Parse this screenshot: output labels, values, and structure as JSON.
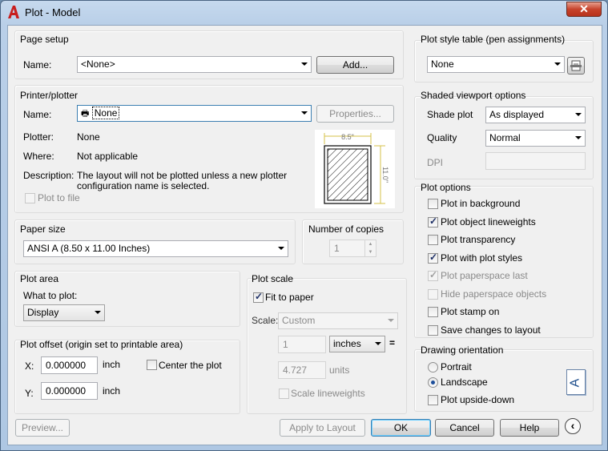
{
  "window": {
    "title": "Plot - Model",
    "close_glyph": "✕",
    "logo_letter": "A"
  },
  "page_setup": {
    "title": "Page setup",
    "name_label": "Name:",
    "name_value": "<None>",
    "add_button": "Add..."
  },
  "printer": {
    "title": "Printer/plotter",
    "name_label": "Name:",
    "name_value": "None",
    "properties_button": "Properties...",
    "plotter_label": "Plotter:",
    "plotter_value": "None",
    "where_label": "Where:",
    "where_value": "Not applicable",
    "description_label": "Description:",
    "description_line1": "The layout will not be plotted unless a new plotter",
    "description_line2": "configuration name is selected.",
    "plot_to_file": "Plot to file",
    "preview_width": "8.5\"",
    "preview_height": "11.0\""
  },
  "paper_size": {
    "title": "Paper size",
    "value": "ANSI A (8.50 x 11.00 Inches)"
  },
  "copies": {
    "title": "Number of copies",
    "value": "1"
  },
  "plot_area": {
    "title": "Plot area",
    "what_label": "What to plot:",
    "what_value": "Display"
  },
  "plot_offset": {
    "title": "Plot offset (origin set to printable area)",
    "x_label": "X:",
    "x_value": "0.000000",
    "x_unit": "inch",
    "y_label": "Y:",
    "y_value": "0.000000",
    "y_unit": "inch",
    "center_label": "Center the plot"
  },
  "plot_scale": {
    "title": "Plot scale",
    "fit_label": "Fit to paper",
    "scale_label": "Scale:",
    "scale_value": "Custom",
    "num_value": "1",
    "unit_value": "inches",
    "equals": "=",
    "den_value": "4.727",
    "den_unit": "units",
    "lineweights_label": "Scale lineweights"
  },
  "plot_style": {
    "title": "Plot style table (pen assignments)",
    "value": "None"
  },
  "shaded": {
    "title": "Shaded viewport options",
    "shade_label": "Shade plot",
    "shade_value": "As displayed",
    "quality_label": "Quality",
    "quality_value": "Normal",
    "dpi_label": "DPI",
    "dpi_value": ""
  },
  "plot_options": {
    "title": "Plot options",
    "items": [
      {
        "label": "Plot in background",
        "checked": false,
        "disabled": false
      },
      {
        "label": "Plot object lineweights",
        "checked": true,
        "disabled": false
      },
      {
        "label": "Plot transparency",
        "checked": false,
        "disabled": false
      },
      {
        "label": "Plot with plot styles",
        "checked": true,
        "disabled": false
      },
      {
        "label": "Plot paperspace last",
        "checked": true,
        "disabled": true
      },
      {
        "label": "Hide paperspace objects",
        "checked": false,
        "disabled": true
      },
      {
        "label": "Plot stamp on",
        "checked": false,
        "disabled": false
      },
      {
        "label": "Save changes to layout",
        "checked": false,
        "disabled": false
      }
    ]
  },
  "orientation": {
    "title": "Drawing orientation",
    "portrait": "Portrait",
    "landscape": "Landscape",
    "upside_down": "Plot upside-down",
    "icon_letter": "A"
  },
  "footer": {
    "preview": "Preview...",
    "apply": "Apply to Layout",
    "ok": "OK",
    "cancel": "Cancel",
    "help": "Help",
    "expand_glyph": "‹"
  }
}
